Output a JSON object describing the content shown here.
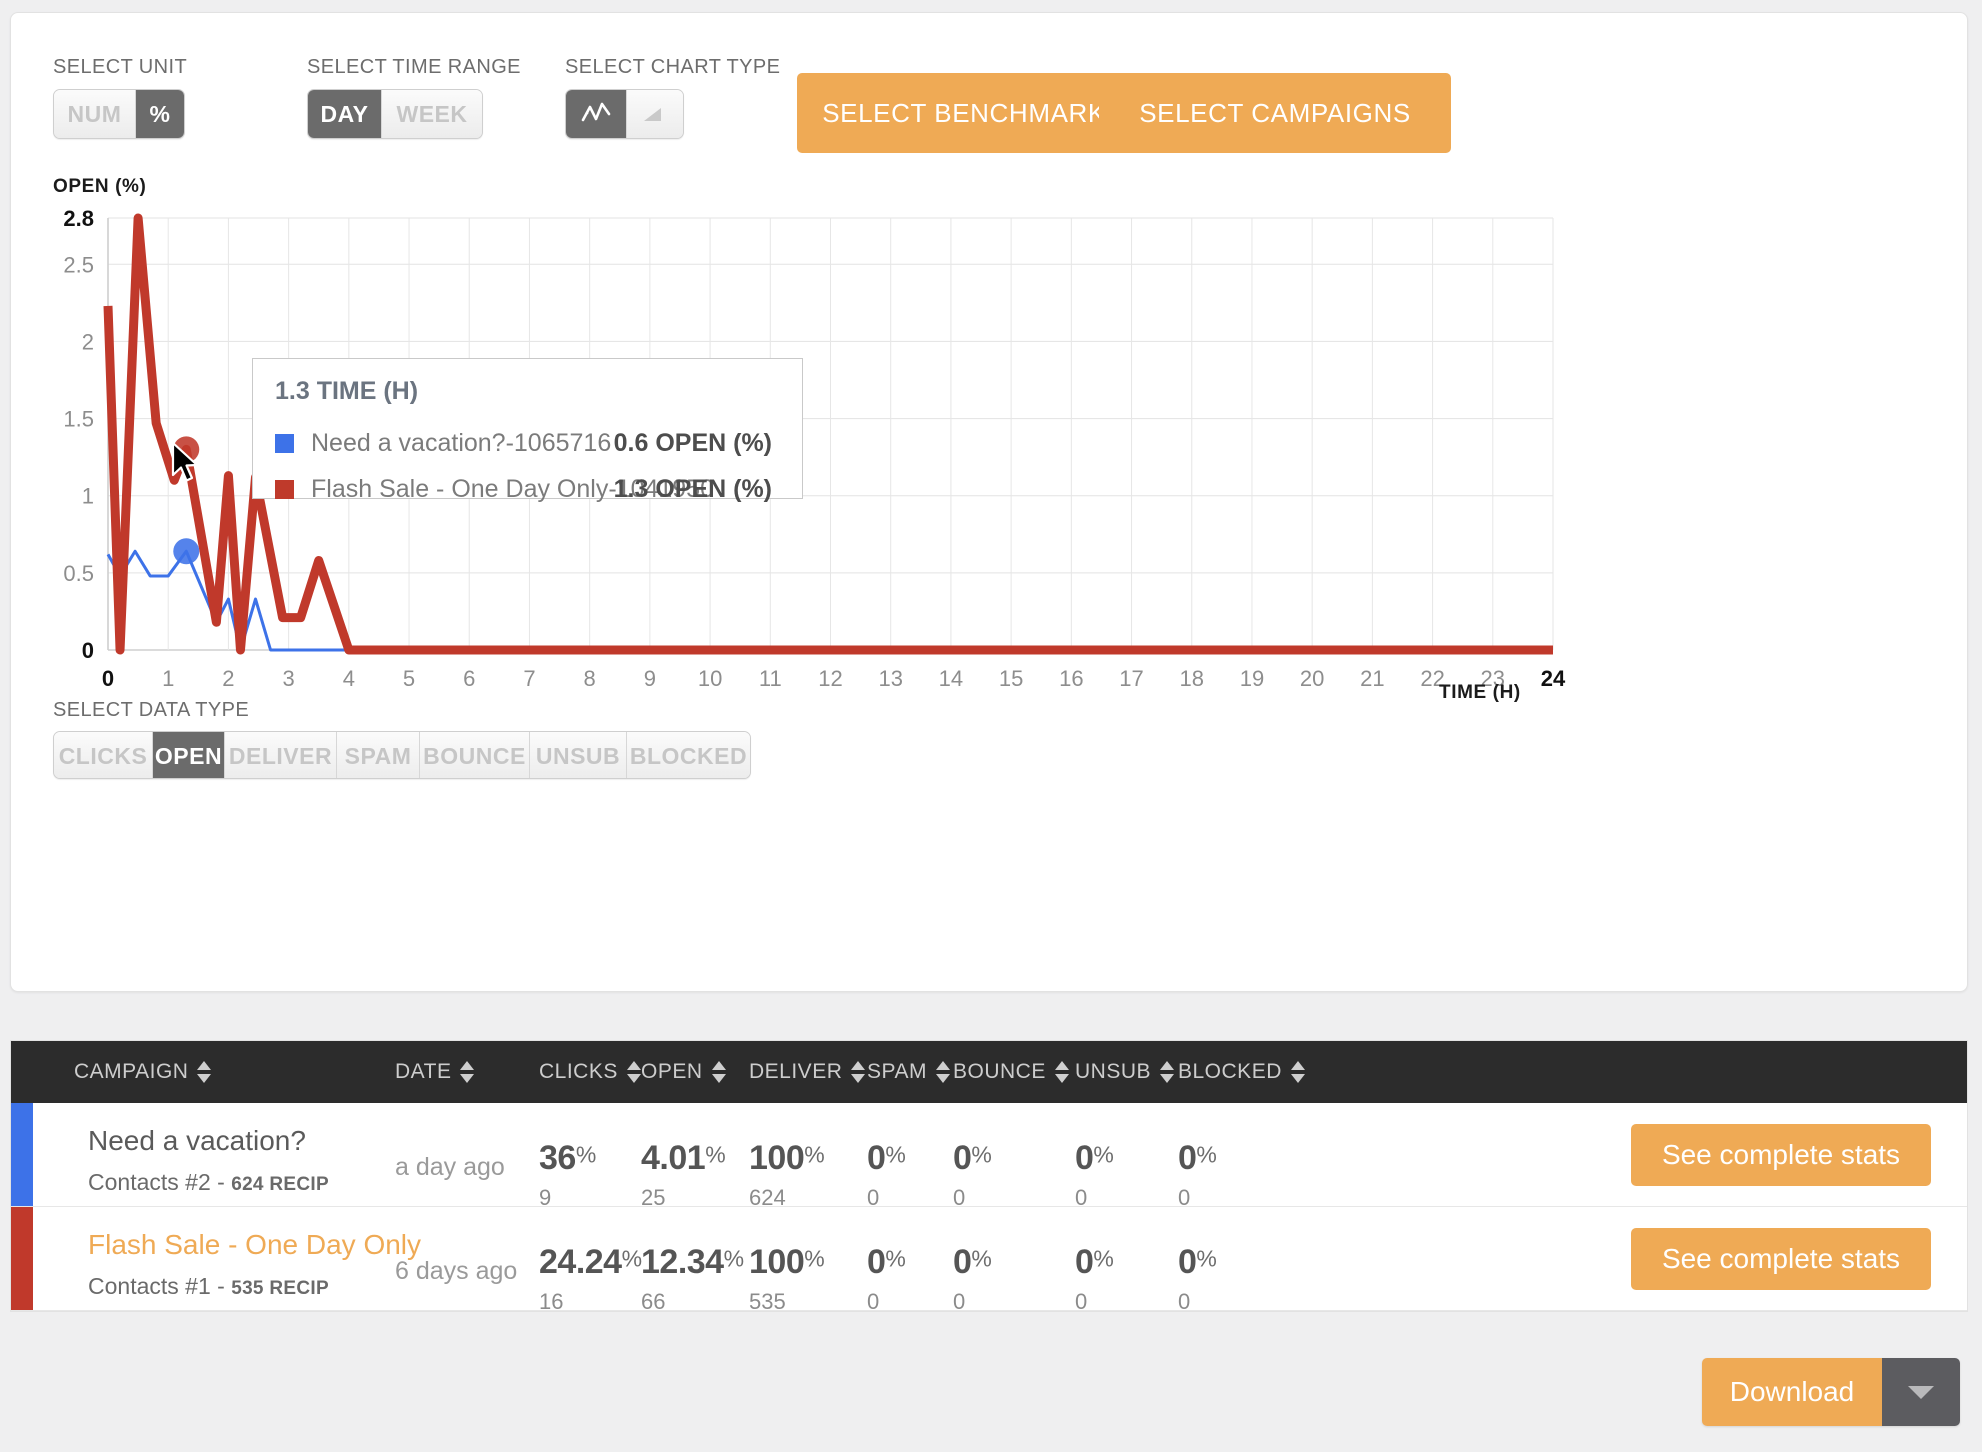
{
  "toolbar": {
    "unit": {
      "label": "SELECT UNIT",
      "options": [
        "NUM",
        "%"
      ],
      "selected": "%"
    },
    "time_range": {
      "label": "SELECT TIME RANGE",
      "options": [
        "DAY",
        "WEEK"
      ],
      "selected": "DAY"
    },
    "chart_type": {
      "label": "SELECT CHART TYPE",
      "options": [
        "line-chart-icon",
        "area-chart-icon"
      ],
      "selected": "line-chart-icon"
    },
    "select_benchmarks": "SELECT BENCHMARKS",
    "select_campaigns": "SELECT CAMPAIGNS"
  },
  "data_type": {
    "label": "SELECT DATA TYPE",
    "options": [
      "CLICKS",
      "OPEN",
      "DELIVER",
      "SPAM",
      "BOUNCE",
      "UNSUB",
      "BLOCKED"
    ],
    "selected": "OPEN"
  },
  "tooltip": {
    "title": "1.3 TIME (H)",
    "rows": [
      {
        "color": "#3d72e8",
        "name": "Need a vacation?-1065716",
        "value": "0.6 OPEN (%)"
      },
      {
        "color": "#bf3a2b",
        "name": "Flash Sale - One Day Only-1041950",
        "value": "1.3 OPEN (%)"
      }
    ]
  },
  "chart_data": {
    "type": "line",
    "title": "",
    "ylabel": "OPEN (%)",
    "xlabel": "TIME (H)",
    "xlim": [
      0,
      24
    ],
    "ylim": [
      0,
      2.8
    ],
    "grid": true,
    "legend": "none",
    "xticks": [
      "0",
      "1",
      "2",
      "3",
      "4",
      "5",
      "6",
      "7",
      "8",
      "9",
      "10",
      "11",
      "12",
      "13",
      "14",
      "15",
      "16",
      "17",
      "18",
      "19",
      "20",
      "21",
      "22",
      "23",
      "24"
    ],
    "yticks": [
      "0",
      "0.5",
      "1",
      "1.5",
      "2",
      "2.5",
      "2.8"
    ],
    "series": [
      {
        "name": "Need a vacation?-1065716",
        "color": "#3d72e8",
        "points": [
          [
            0,
            0.62
          ],
          [
            0.2,
            0.48
          ],
          [
            0.45,
            0.64
          ],
          [
            0.7,
            0.48
          ],
          [
            1.0,
            0.48
          ],
          [
            1.3,
            0.64
          ],
          [
            1.8,
            0.18
          ],
          [
            2.0,
            0.33
          ],
          [
            2.2,
            0.0
          ],
          [
            2.45,
            0.33
          ],
          [
            2.7,
            0.0
          ],
          [
            4.0,
            0.0
          ],
          [
            24,
            0.0
          ]
        ],
        "marker": {
          "x": 1.3,
          "y": 0.64
        }
      },
      {
        "name": "Flash Sale - One Day Only-1041950",
        "color": "#c0392b",
        "points": [
          [
            0,
            2.23
          ],
          [
            0.2,
            0.0
          ],
          [
            0.5,
            2.8
          ],
          [
            0.8,
            1.47
          ],
          [
            1.1,
            1.1
          ],
          [
            1.3,
            1.3
          ],
          [
            1.8,
            0.18
          ],
          [
            2.0,
            1.13
          ],
          [
            2.2,
            0.0
          ],
          [
            2.45,
            1.12
          ],
          [
            2.9,
            0.21
          ],
          [
            3.2,
            0.21
          ],
          [
            3.5,
            0.58
          ],
          [
            4.0,
            0.0
          ],
          [
            24,
            0.0
          ]
        ],
        "marker": {
          "x": 1.3,
          "y": 1.3
        }
      }
    ]
  },
  "table": {
    "columns": [
      "CAMPAIGN",
      "DATE",
      "CLICKS",
      "OPEN",
      "DELIVER",
      "SPAM",
      "BOUNCE",
      "UNSUB",
      "BLOCKED"
    ],
    "action_label": "See complete stats",
    "rows": [
      {
        "bar_color": "#3d72e8",
        "name": "Need a vacation?",
        "name_color": "#5a5a5a",
        "list": "Contacts #2",
        "recip": "624 RECIP",
        "date": "a day ago",
        "clicks": {
          "pct": "36",
          "count": "9"
        },
        "open": {
          "pct": "4.01",
          "count": "25"
        },
        "deliver": {
          "pct": "100",
          "count": "624"
        },
        "spam": {
          "pct": "0",
          "count": "0"
        },
        "bounce": {
          "pct": "0",
          "count": "0"
        },
        "unsub": {
          "pct": "0",
          "count": "0"
        },
        "blocked": {
          "pct": "0",
          "count": "0"
        }
      },
      {
        "bar_color": "#c0392b",
        "name": "Flash Sale - One Day Only",
        "name_color": "#efaa55",
        "list": "Contacts #1",
        "recip": "535 RECIP",
        "date": "6 days ago",
        "clicks": {
          "pct": "24.24",
          "count": "16"
        },
        "open": {
          "pct": "12.34",
          "count": "66"
        },
        "deliver": {
          "pct": "100",
          "count": "535"
        },
        "spam": {
          "pct": "0",
          "count": "0"
        },
        "bounce": {
          "pct": "0",
          "count": "0"
        },
        "unsub": {
          "pct": "0",
          "count": "0"
        },
        "blocked": {
          "pct": "0",
          "count": "0"
        }
      }
    ]
  },
  "download": {
    "label": "Download",
    "caret": "chevron-down-icon"
  }
}
